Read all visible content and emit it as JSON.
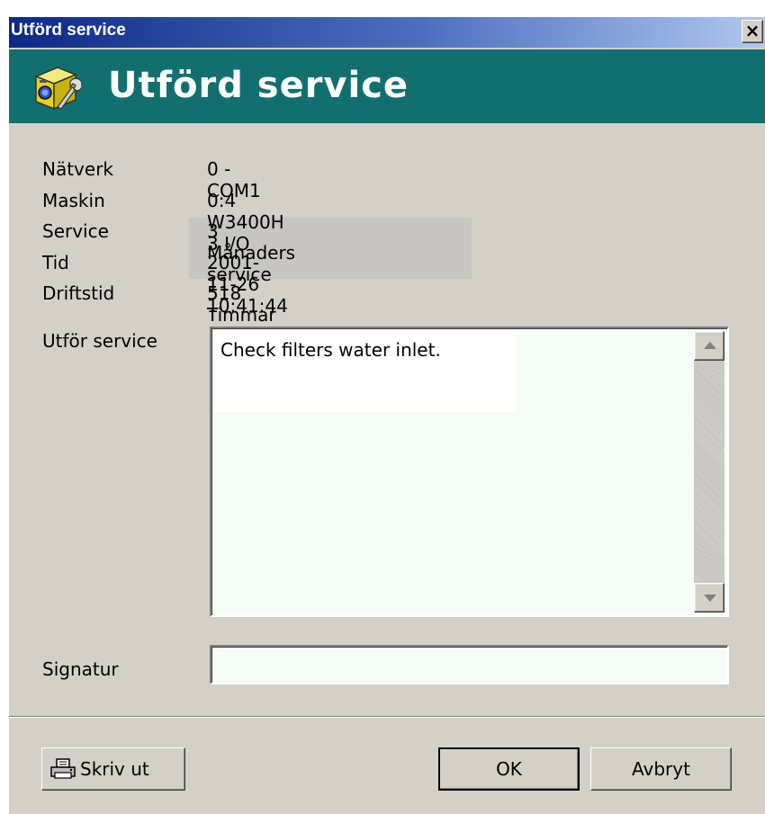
{
  "window": {
    "title": "Utförd service",
    "close_glyph": "×"
  },
  "banner": {
    "heading": "Utförd service",
    "icon": "washing-machine-wrench-icon"
  },
  "info": {
    "rows": [
      {
        "label": "Nätverk",
        "value": "0 - COM1"
      },
      {
        "label": "Maskin",
        "value": "0:4 W3400H 3 I/O"
      },
      {
        "label": "Service",
        "value": "3 Månaders service"
      },
      {
        "label": "Tid",
        "value": "2001-11-26 10:41:44"
      },
      {
        "label": "Driftstid",
        "value": "518 Timmar"
      }
    ]
  },
  "service_text": {
    "label": "Utför service",
    "value": "Check filters water inlet."
  },
  "signature": {
    "label": "Signatur",
    "value": ""
  },
  "buttons": {
    "print_label": "Skriv ut",
    "print_icon": "printer-icon",
    "ok_label": "OK",
    "cancel_label": "Avbryt"
  },
  "colors": {
    "banner": "#11706f",
    "dialog_face": "#d4d0c8",
    "title_gradient_start": "#0c2a86",
    "input_bg": "#f5fbf5"
  }
}
